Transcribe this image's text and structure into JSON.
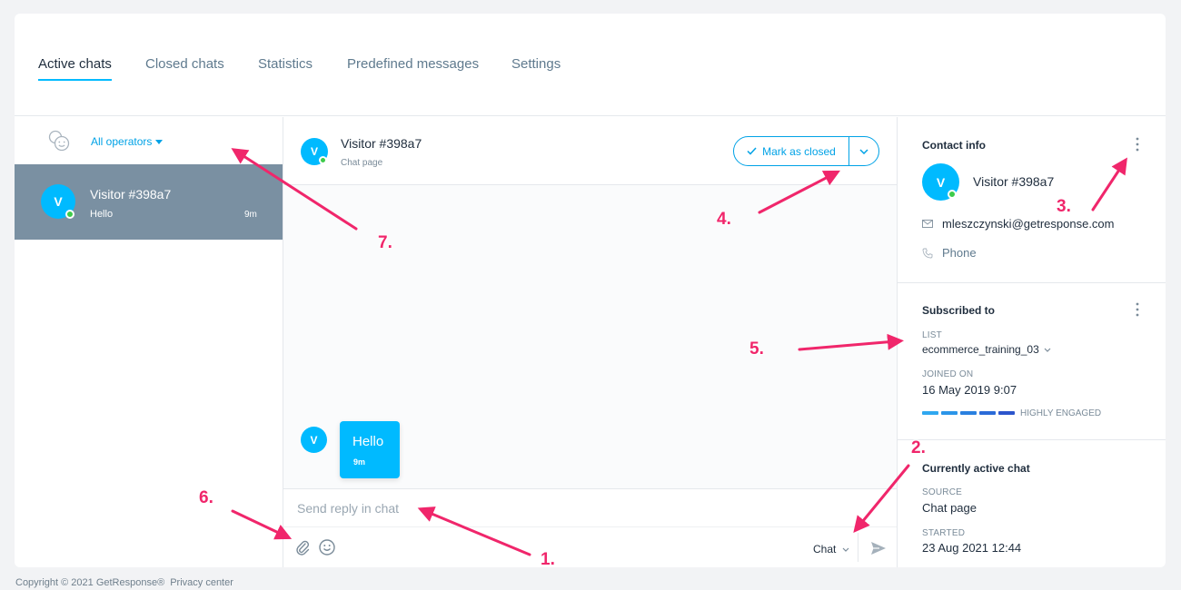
{
  "tabs": [
    {
      "label": "Active chats",
      "active": true
    },
    {
      "label": "Closed chats"
    },
    {
      "label": "Statistics"
    },
    {
      "label": "Predefined messages"
    },
    {
      "label": "Settings"
    }
  ],
  "left": {
    "operators_filter": "All operators",
    "chats": [
      {
        "avatar": "V",
        "name": "Visitor #398a7",
        "message": "Hello",
        "time": "9m"
      }
    ]
  },
  "conversation": {
    "avatar": "V",
    "name": "Visitor #398a7",
    "subtitle": "Chat page",
    "mark_closed_label": "Mark as closed",
    "messages": [
      {
        "avatar": "V",
        "text": "Hello",
        "time": "9m"
      }
    ],
    "reply_placeholder": "Send reply in chat",
    "channel": "Chat"
  },
  "contact": {
    "title": "Contact info",
    "avatar": "V",
    "name": "Visitor #398a7",
    "email": "mleszczynski@getresponse.com",
    "phone": "Phone"
  },
  "subscribed": {
    "title": "Subscribed to",
    "list_label": "LIST",
    "list_value": "ecommerce_training_03",
    "joined_label": "JOINED ON",
    "joined_value": "16 May 2019 9:07",
    "engagement_label": "HIGHLY ENGAGED",
    "engagement_level": 5,
    "engagement_colors": [
      "#2fa8f0",
      "#2b95e8",
      "#2a80e0",
      "#2b6bd8",
      "#2c55cc"
    ]
  },
  "active_chat": {
    "title": "Currently active chat",
    "source_label": "SOURCE",
    "source_value": "Chat page",
    "started_label": "STARTED",
    "started_value": "23 Aug 2021 12:44"
  },
  "footer": {
    "copyright": "Copyright © 2021 GetResponse®",
    "privacy": "Privacy center"
  },
  "annotations": [
    "1.",
    "2.",
    "3.",
    "4.",
    "5.",
    "6.",
    "7."
  ],
  "colors": {
    "accent": "#00baff",
    "annotation": "#f0266b",
    "selected_chat": "#7a90a2",
    "online": "#3ecb4a"
  }
}
